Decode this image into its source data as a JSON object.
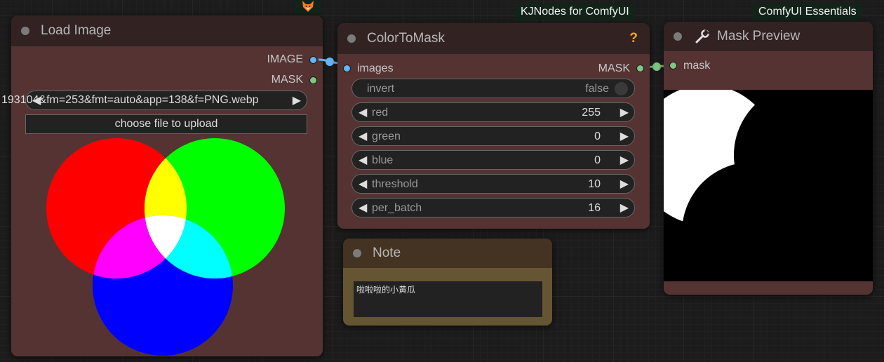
{
  "load_image": {
    "title": "Load Image",
    "outputs": [
      "IMAGE",
      "MASK"
    ],
    "filename": "193104&fm=253&fmt=auto&app=138&f=PNG.webp",
    "upload_label": "choose file to upload"
  },
  "color_to_mask": {
    "badge": "KJNodes for ComfyUI",
    "title": "ColorToMask",
    "help": "?",
    "input": "images",
    "output": "MASK",
    "toggle": {
      "label": "invert",
      "value": "false"
    },
    "widgets": [
      {
        "label": "red",
        "value": "255"
      },
      {
        "label": "green",
        "value": "0"
      },
      {
        "label": "blue",
        "value": "0"
      },
      {
        "label": "threshold",
        "value": "10"
      },
      {
        "label": "per_batch",
        "value": "16"
      }
    ]
  },
  "note": {
    "title": "Note",
    "text": "啦啦啦的小黄瓜"
  },
  "mask_preview": {
    "badge": "ComfyUI Essentials",
    "title": "Mask Preview",
    "input": "mask"
  },
  "colors": {
    "node_body": "#553333",
    "node_title": "#332222",
    "note_body": "#665533",
    "note_title": "#432",
    "image_slot": "#64b5f6",
    "mask_slot": "#81c784"
  }
}
